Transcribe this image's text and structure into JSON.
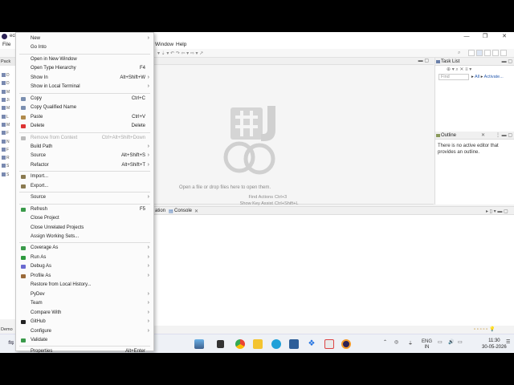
{
  "window": {
    "title": "ecl",
    "minimize": "—",
    "maximize": "❐",
    "close": "✕"
  },
  "menubar": {
    "window": "Window",
    "help": "Help",
    "file": "File"
  },
  "package_explorer": {
    "tab": "Pack",
    "rows": [
      "D",
      "D",
      "M",
      "Ji",
      "M",
      "L",
      "M",
      "F",
      "N",
      "F",
      "R",
      "S",
      "S",
      "S",
      "Sr"
    ]
  },
  "editor": {
    "message": "Open a file or drop files here to open them.",
    "hints": [
      {
        "key": "Find Actions",
        "value": "Ctrl+3"
      },
      {
        "key": "Show Key Assist",
        "value": "Ctrl+Shift+L"
      },
      {
        "key": "New",
        "value": "Ctrl+N"
      },
      {
        "key": "Open Type",
        "value": "Ctrl+Shift+T"
      }
    ]
  },
  "task_list": {
    "tab": "Task List",
    "find_placeholder": "Find",
    "all": "All",
    "activate": "Activate..."
  },
  "outline": {
    "tab": "Outline",
    "message": "There is no active editor that provides an outline."
  },
  "console": {
    "tab_partial": "ation",
    "tab": "Console"
  },
  "statusbar": {
    "label": "Demo"
  },
  "taskbar": {
    "lang": "ENG",
    "region": "IN",
    "time": "11:30",
    "date": "30-05-2026"
  },
  "context_menu": [
    {
      "label": "New",
      "submenu": true,
      "icon": ""
    },
    {
      "label": "Go Into"
    },
    {
      "sep": true
    },
    {
      "label": "Open in New Window"
    },
    {
      "label": "Open Type Hierarchy",
      "shortcut": "F4"
    },
    {
      "label": "Show In",
      "shortcut": "Alt+Shift+W",
      "submenu": true
    },
    {
      "label": "Show in Local Terminal",
      "submenu": true
    },
    {
      "sep": true
    },
    {
      "label": "Copy",
      "shortcut": "Ctrl+C",
      "icon": "copy-icon"
    },
    {
      "label": "Copy Qualified Name",
      "icon": "copy-icon"
    },
    {
      "label": "Paste",
      "shortcut": "Ctrl+V",
      "icon": "paste-icon"
    },
    {
      "label": "Delete",
      "shortcut": "Delete",
      "icon": "delete-icon"
    },
    {
      "sep": true
    },
    {
      "label": "Remove from Context",
      "shortcut": "Ctrl+Alt+Shift+Down",
      "disabled": true,
      "icon": "remove-icon"
    },
    {
      "label": "Build Path",
      "submenu": true
    },
    {
      "label": "Source",
      "shortcut": "Alt+Shift+S",
      "submenu": true
    },
    {
      "label": "Refactor",
      "shortcut": "Alt+Shift+T",
      "submenu": true
    },
    {
      "sep": true
    },
    {
      "label": "Import...",
      "icon": "import-icon"
    },
    {
      "label": "Export...",
      "icon": "export-icon"
    },
    {
      "sep": true
    },
    {
      "label": "Source",
      "submenu": true
    },
    {
      "sep": true
    },
    {
      "label": "Refresh",
      "shortcut": "F5",
      "icon": "refresh-icon"
    },
    {
      "label": "Close Project"
    },
    {
      "label": "Close Unrelated Projects"
    },
    {
      "label": "Assign Working Sets..."
    },
    {
      "sep": true
    },
    {
      "label": "Coverage As",
      "submenu": true,
      "icon": "coverage-icon"
    },
    {
      "label": "Run As",
      "submenu": true,
      "icon": "run-icon"
    },
    {
      "label": "Debug As",
      "submenu": true,
      "icon": "debug-icon"
    },
    {
      "label": "Profile As",
      "submenu": true,
      "icon": "profile-icon"
    },
    {
      "label": "Restore from Local History..."
    },
    {
      "label": "PyDev",
      "submenu": true
    },
    {
      "label": "Team",
      "submenu": true
    },
    {
      "label": "Compare With",
      "submenu": true
    },
    {
      "label": "GitHub",
      "submenu": true,
      "icon": "github-icon"
    },
    {
      "label": "Configure",
      "submenu": true
    },
    {
      "label": "Validate",
      "icon": "validate-icon"
    },
    {
      "sep": true
    },
    {
      "label": "Properties",
      "shortcut": "Alt+Enter"
    }
  ],
  "colors": {
    "accent": "#2c2255",
    "link": "#2a5db0",
    "menu_bg": "#fbfbfb"
  }
}
